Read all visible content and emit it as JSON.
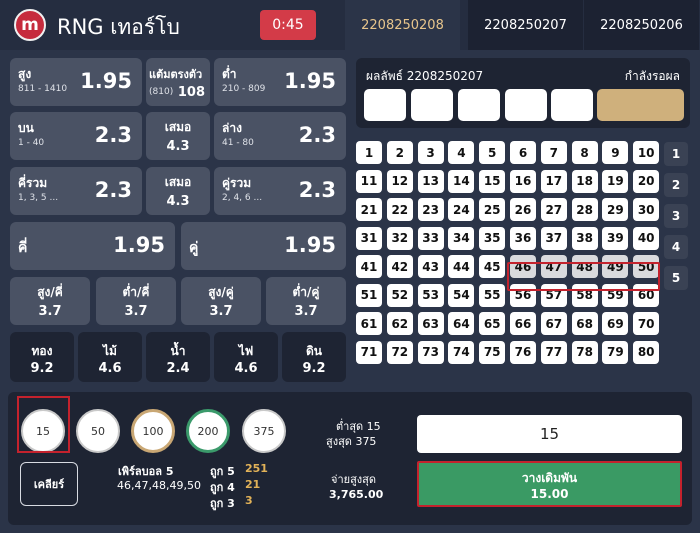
{
  "header": {
    "logo_text": "m",
    "title": "RNG เทอร์โบ",
    "timer": "0:45",
    "rounds": [
      "2208250208",
      "2208250207",
      "2208250206"
    ]
  },
  "bets": {
    "high": {
      "label": "สูง",
      "range": "811 - 1410",
      "odd": "1.95"
    },
    "tie810": {
      "label": "แต้มตรงตัว",
      "range": "(810)",
      "odd": "108"
    },
    "low": {
      "label": "ต่ำ",
      "range": "210 - 809",
      "odd": "1.95"
    },
    "top": {
      "label": "บน",
      "range": "1 - 40",
      "odd": "2.3"
    },
    "draw1": {
      "label": "เสมอ",
      "odd": "4.3"
    },
    "bottom": {
      "label": "ล่าง",
      "range": "41 - 80",
      "odd": "2.3"
    },
    "oddsum": {
      "label": "คี่รวม",
      "range": "1, 3, 5 ...",
      "odd": "2.3"
    },
    "draw2": {
      "label": "เสมอ",
      "odd": "4.3"
    },
    "evensum": {
      "label": "คู่รวม",
      "range": "2, 4, 6 ...",
      "odd": "2.3"
    },
    "odd_bet": {
      "label": "คี่",
      "odd": "1.95"
    },
    "even_bet": {
      "label": "คู่",
      "odd": "1.95"
    },
    "combos": [
      {
        "label": "สูง/คี่",
        "odd": "3.7"
      },
      {
        "label": "ต่ำ/คี่",
        "odd": "3.7"
      },
      {
        "label": "สูง/คู่",
        "odd": "3.7"
      },
      {
        "label": "ต่ำ/คู่",
        "odd": "3.7"
      }
    ],
    "elements": [
      {
        "label": "ทอง",
        "odd": "9.2"
      },
      {
        "label": "ไม้",
        "odd": "4.6"
      },
      {
        "label": "น้ำ",
        "odd": "2.4"
      },
      {
        "label": "ไฟ",
        "odd": "4.6"
      },
      {
        "label": "ดิน",
        "odd": "9.2"
      }
    ]
  },
  "result": {
    "label": "ผลลัพธ์ 2208250207",
    "status": "กำลังรอผล"
  },
  "grid": {
    "numbers": [
      1,
      2,
      3,
      4,
      5,
      6,
      7,
      8,
      9,
      10,
      11,
      12,
      13,
      14,
      15,
      16,
      17,
      18,
      19,
      20,
      21,
      22,
      23,
      24,
      25,
      26,
      27,
      28,
      29,
      30,
      31,
      32,
      33,
      34,
      35,
      36,
      37,
      38,
      39,
      40,
      41,
      42,
      43,
      44,
      45,
      46,
      47,
      48,
      49,
      50,
      51,
      52,
      53,
      54,
      55,
      56,
      57,
      58,
      59,
      60,
      61,
      62,
      63,
      64,
      65,
      66,
      67,
      68,
      69,
      70,
      71,
      72,
      73,
      74,
      75,
      76,
      77,
      78,
      79,
      80
    ],
    "selected": [
      46,
      47,
      48,
      49,
      50
    ],
    "row_buttons": [
      "1",
      "2",
      "3",
      "4",
      "5"
    ]
  },
  "chips": [
    "15",
    "50",
    "100",
    "200",
    "375"
  ],
  "selected_chip": "15",
  "bet_panel": {
    "clear_label": "เคลียร์",
    "perm_title": "เพิร์ลบอล 5",
    "perm_numbers": "46,47,48,49,50",
    "hits": [
      {
        "label": "ถูก 5",
        "value": "251"
      },
      {
        "label": "ถูก 4",
        "value": "21"
      },
      {
        "label": "ถูก 3",
        "value": "3"
      }
    ],
    "min_label": "ต่ำสุด 15",
    "max_label": "สูงสุด 375",
    "amount": "15",
    "max_pay_label": "จ่ายสูงสุด",
    "max_pay_value": "3,765.00",
    "place_label": "วางเดิมพัน",
    "place_amount": "15.00"
  },
  "colors": {
    "background": "#2b3448",
    "card": "#4a5264",
    "dark_panel": "#1e2433",
    "timer": "#d33b48",
    "active_tab_text": "#e7c58c",
    "place_button": "#3a9a64",
    "highlight_outline": "#c4222d",
    "hit_value": "#e2b258"
  }
}
